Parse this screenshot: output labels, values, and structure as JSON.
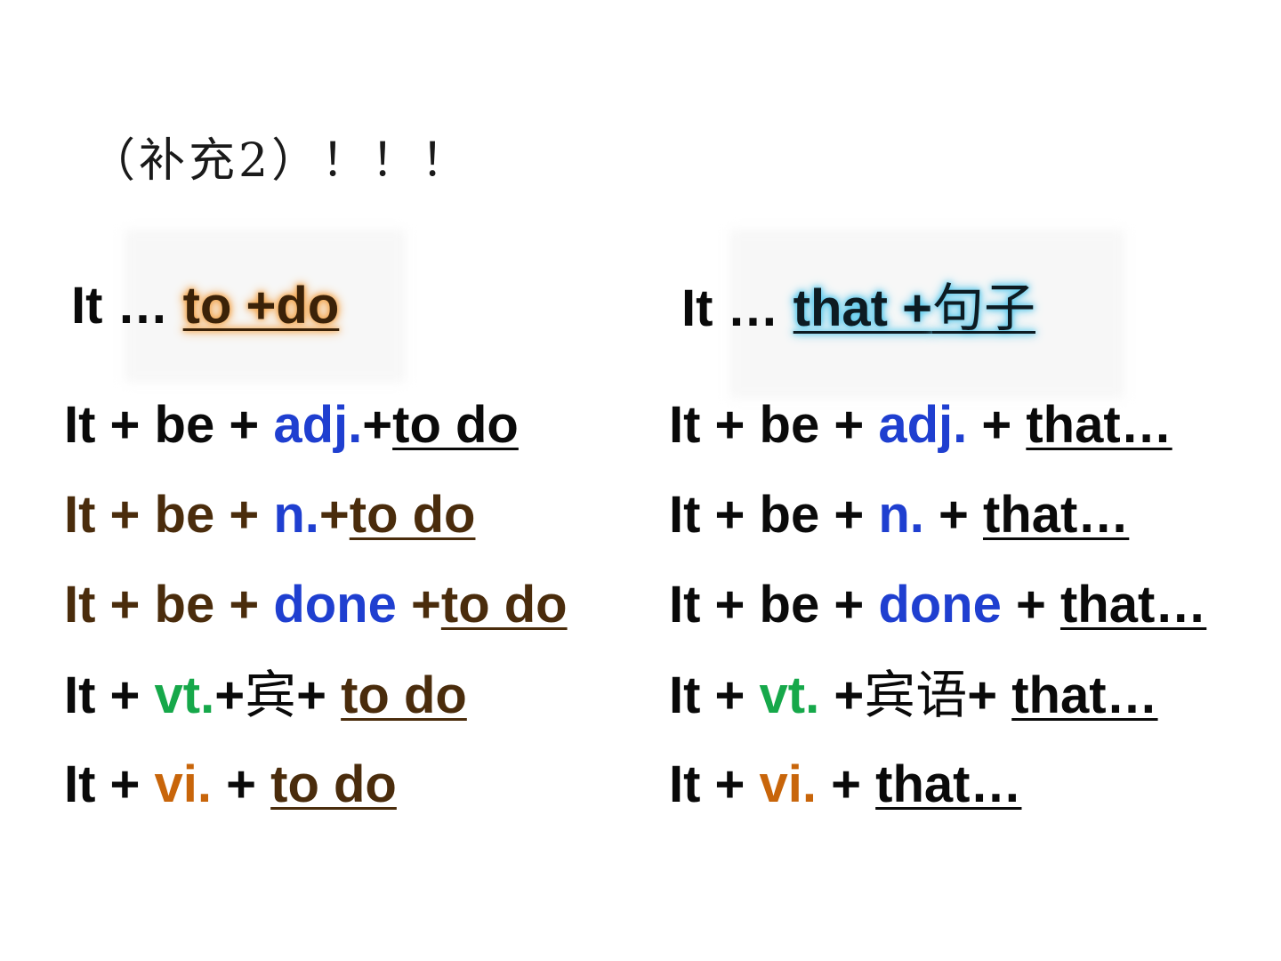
{
  "title": "（补充2）！！！",
  "colors": {
    "black": "#0a0a0a",
    "brown": "#4a2c0c",
    "blue": "#1f3fd0",
    "green": "#16a84a",
    "orange": "#c8650a",
    "highlight_orange": "#f3a64f",
    "highlight_blue": "#56c8ec"
  },
  "left": {
    "heading": {
      "prefix": "It … ",
      "keyword": "to +do"
    },
    "rows": [
      {
        "start": "It + be + ",
        "part": "adj.",
        "mid": "+",
        "end": "to do"
      },
      {
        "start": "It + be + ",
        "part": "n.",
        "mid": "+",
        "end": "to do"
      },
      {
        "start": "It + be + ",
        "part": "done",
        "mid": " +",
        "end": "to do"
      },
      {
        "start": "It + ",
        "part": "vt.",
        "mid": "+",
        "obj": "宾",
        "mid2": "+ ",
        "end": "to do"
      },
      {
        "start": "It + ",
        "part": "vi.",
        "mid": " + ",
        "end": "to do"
      }
    ]
  },
  "right": {
    "heading": {
      "prefix": "It … ",
      "keyword": "that +",
      "keyword_cjk": "句子"
    },
    "rows": [
      {
        "start": "It + be + ",
        "part": "adj.",
        "mid": " + ",
        "end": "that…"
      },
      {
        "start": "It + be + ",
        "part": "n.",
        "mid": " + ",
        "end": "that…"
      },
      {
        "start": "It + be + ",
        "part": "done",
        "mid": " + ",
        "end": "that…"
      },
      {
        "start": "It + ",
        "part": "vt.",
        "mid": " +",
        "obj": "宾语",
        "mid2": "+ ",
        "end": "that…"
      },
      {
        "start": "It + ",
        "part": "vi.",
        "mid": " + ",
        "end": "that…"
      }
    ]
  }
}
